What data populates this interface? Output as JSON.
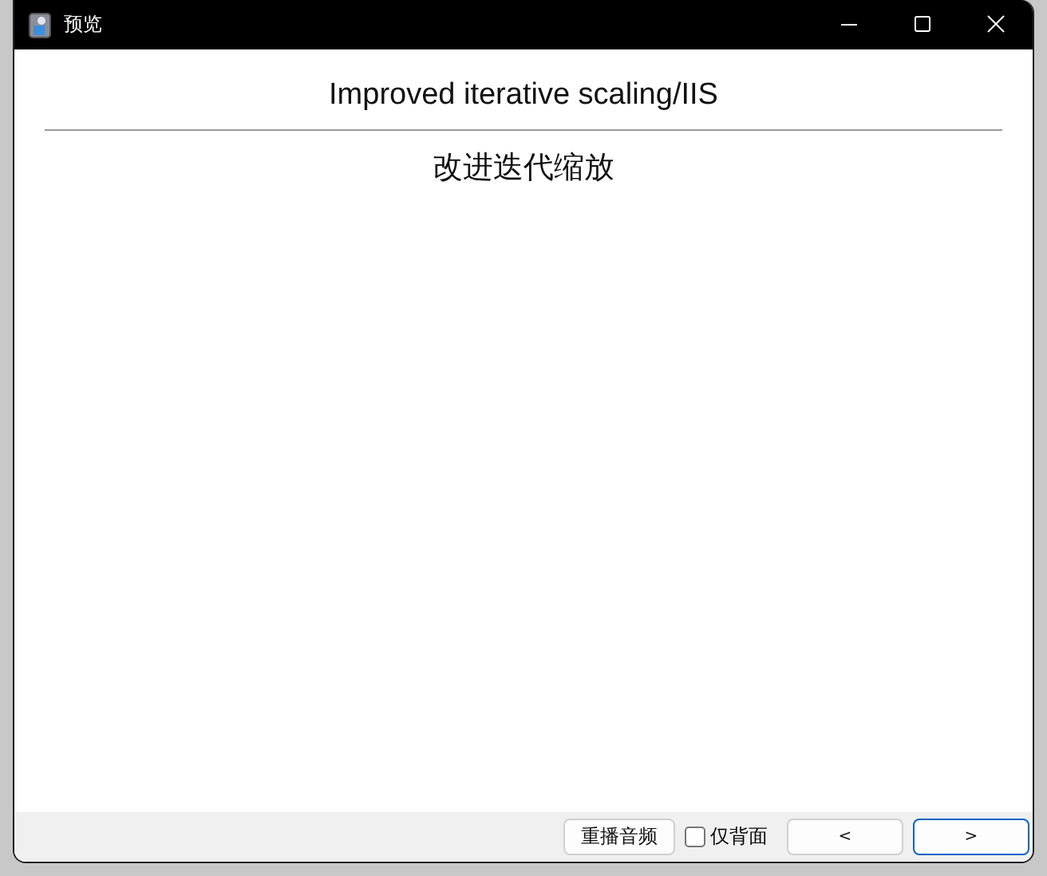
{
  "window": {
    "title": "预览"
  },
  "card": {
    "front": "Improved iterative scaling/IIS",
    "back": "改进迭代缩放"
  },
  "footer": {
    "replay_button": "重播音频",
    "back_only": {
      "label": "仅背面",
      "checked": false
    },
    "prev_button": "<",
    "next_button": ">"
  }
}
